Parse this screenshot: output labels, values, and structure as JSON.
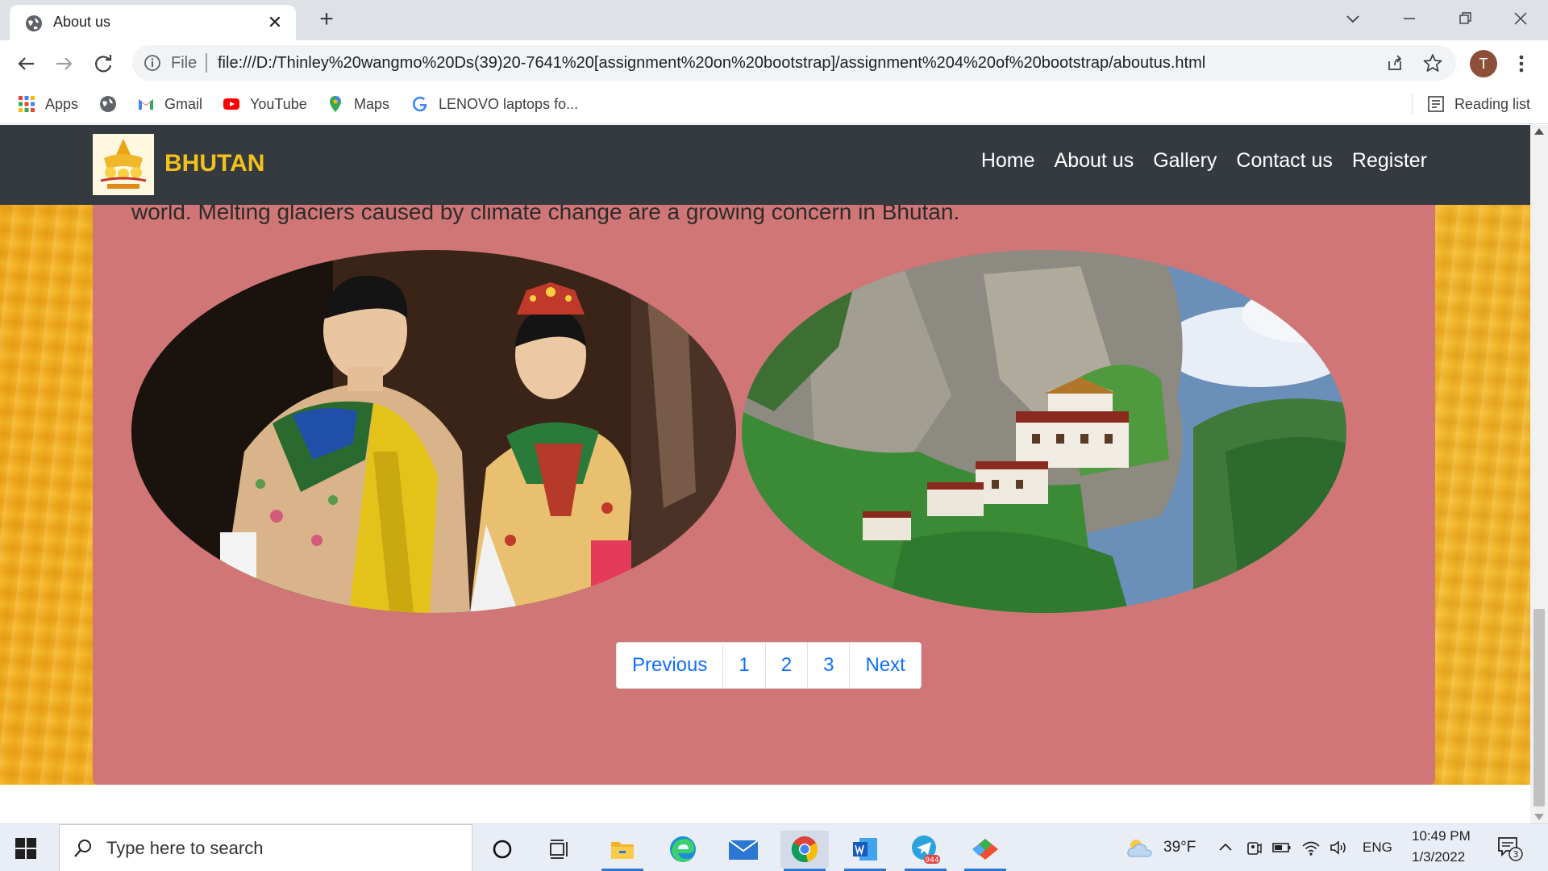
{
  "browser": {
    "tab_title": "About us",
    "url_scheme_label": "File",
    "url": "file:///D:/Thinley%20wangmo%20Ds(39)20-7641%20[assignment%20on%20bootstrap]/assignment%204%20of%20bootstrap/aboutus.html",
    "profile_initial": "T",
    "bookmarks": [
      {
        "label": "Apps",
        "icon": "apps-grid-icon"
      },
      {
        "label": "",
        "icon": "globe-icon"
      },
      {
        "label": "Gmail",
        "icon": "gmail-icon"
      },
      {
        "label": "YouTube",
        "icon": "youtube-icon"
      },
      {
        "label": "Maps",
        "icon": "maps-pin-icon"
      },
      {
        "label": "LENOVO laptops fo...",
        "icon": "google-icon"
      }
    ],
    "reading_list_label": "Reading list"
  },
  "site": {
    "brand": "BHUTAN",
    "nav": [
      "Home",
      "About us",
      "Gallery",
      "Contact us",
      "Register"
    ],
    "paragraph_tail": "world. Melting glaciers caused by climate change are a growing concern in Bhutan.",
    "pagination": [
      "Previous",
      "1",
      "2",
      "3",
      "Next"
    ],
    "colors": {
      "navbar": "#343a40",
      "brand": "#f2c21a",
      "card": "#d17676",
      "link": "#0d6efd"
    }
  },
  "taskbar": {
    "search_placeholder": "Type here to search",
    "weather": "39°F",
    "language": "ENG",
    "time": "10:49 PM",
    "date": "1/3/2022",
    "telegram_badge": "944",
    "notification_count": "3"
  }
}
